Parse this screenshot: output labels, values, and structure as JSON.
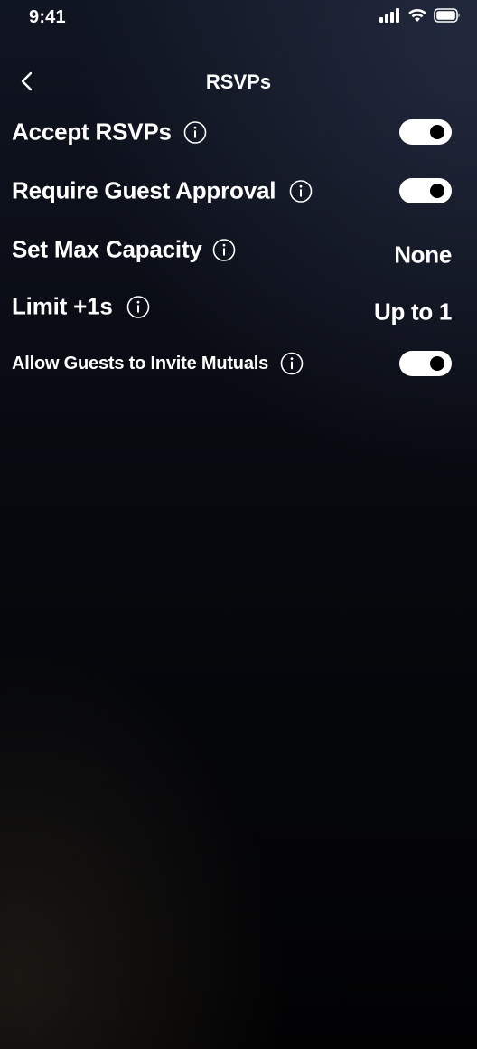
{
  "status_bar": {
    "time": "9:41",
    "icons": [
      "signal-icon",
      "wifi-icon",
      "battery-icon"
    ]
  },
  "nav": {
    "back_icon": "chevron-left-icon",
    "title": "RSVPs"
  },
  "settings": {
    "accept_rsvps": {
      "label": "Accept RSVPs",
      "control": "toggle",
      "enabled": true
    },
    "require_guest_approval": {
      "label": "Require Guest Approval",
      "control": "toggle",
      "enabled": true
    },
    "set_max_capacity": {
      "label": "Set Max Capacity",
      "control": "value",
      "value": "None"
    },
    "limit_plus_ones": {
      "label": "Limit +1s",
      "control": "value",
      "value": "Up to 1"
    },
    "allow_guests_invite_mutuals": {
      "label": "Allow Guests to Invite Mutuals",
      "control": "toggle",
      "enabled": true
    }
  },
  "colors": {
    "text": "#ffffff",
    "toggle_on_track": "#ffffff",
    "toggle_knob": "#000000",
    "background_dark": "#020203",
    "background_top": "#101522"
  }
}
